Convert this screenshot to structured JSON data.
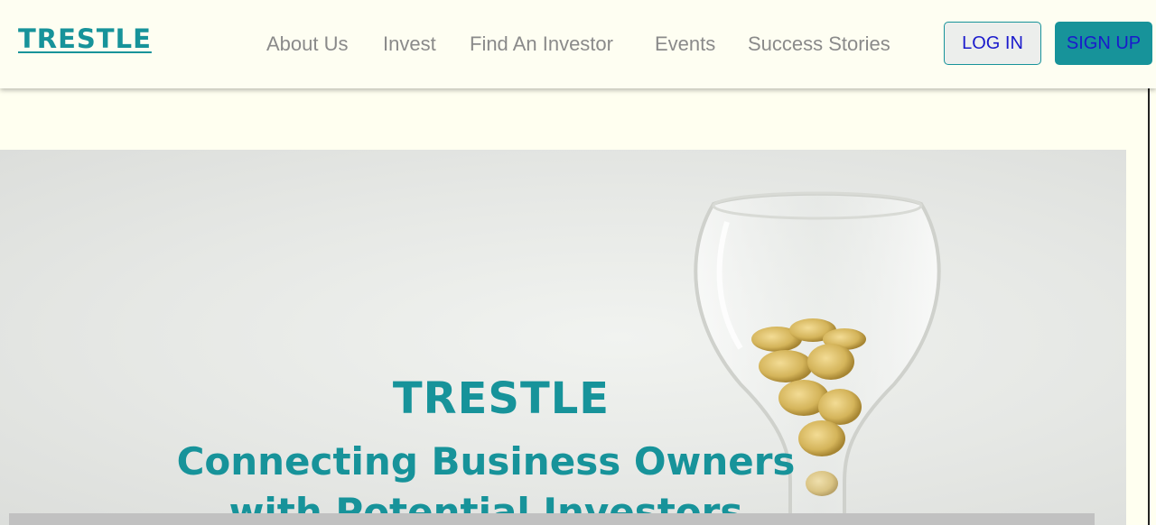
{
  "brand": {
    "logo": "TRESTLE"
  },
  "nav": {
    "items": [
      {
        "label": "About Us"
      },
      {
        "label": "Invest"
      },
      {
        "label": "Find An Investor"
      },
      {
        "label": "Events"
      },
      {
        "label": "Success Stories"
      }
    ],
    "login_label": "LOG IN",
    "signup_label": "SIGN UP"
  },
  "hero": {
    "title": "TRESTLE",
    "subtitle_line1": "Connecting Business Owners",
    "subtitle_line2": "with Potential Investors"
  },
  "colors": {
    "accent": "#17939a",
    "background": "#fffff0",
    "nav_text": "#8a8a8a"
  }
}
